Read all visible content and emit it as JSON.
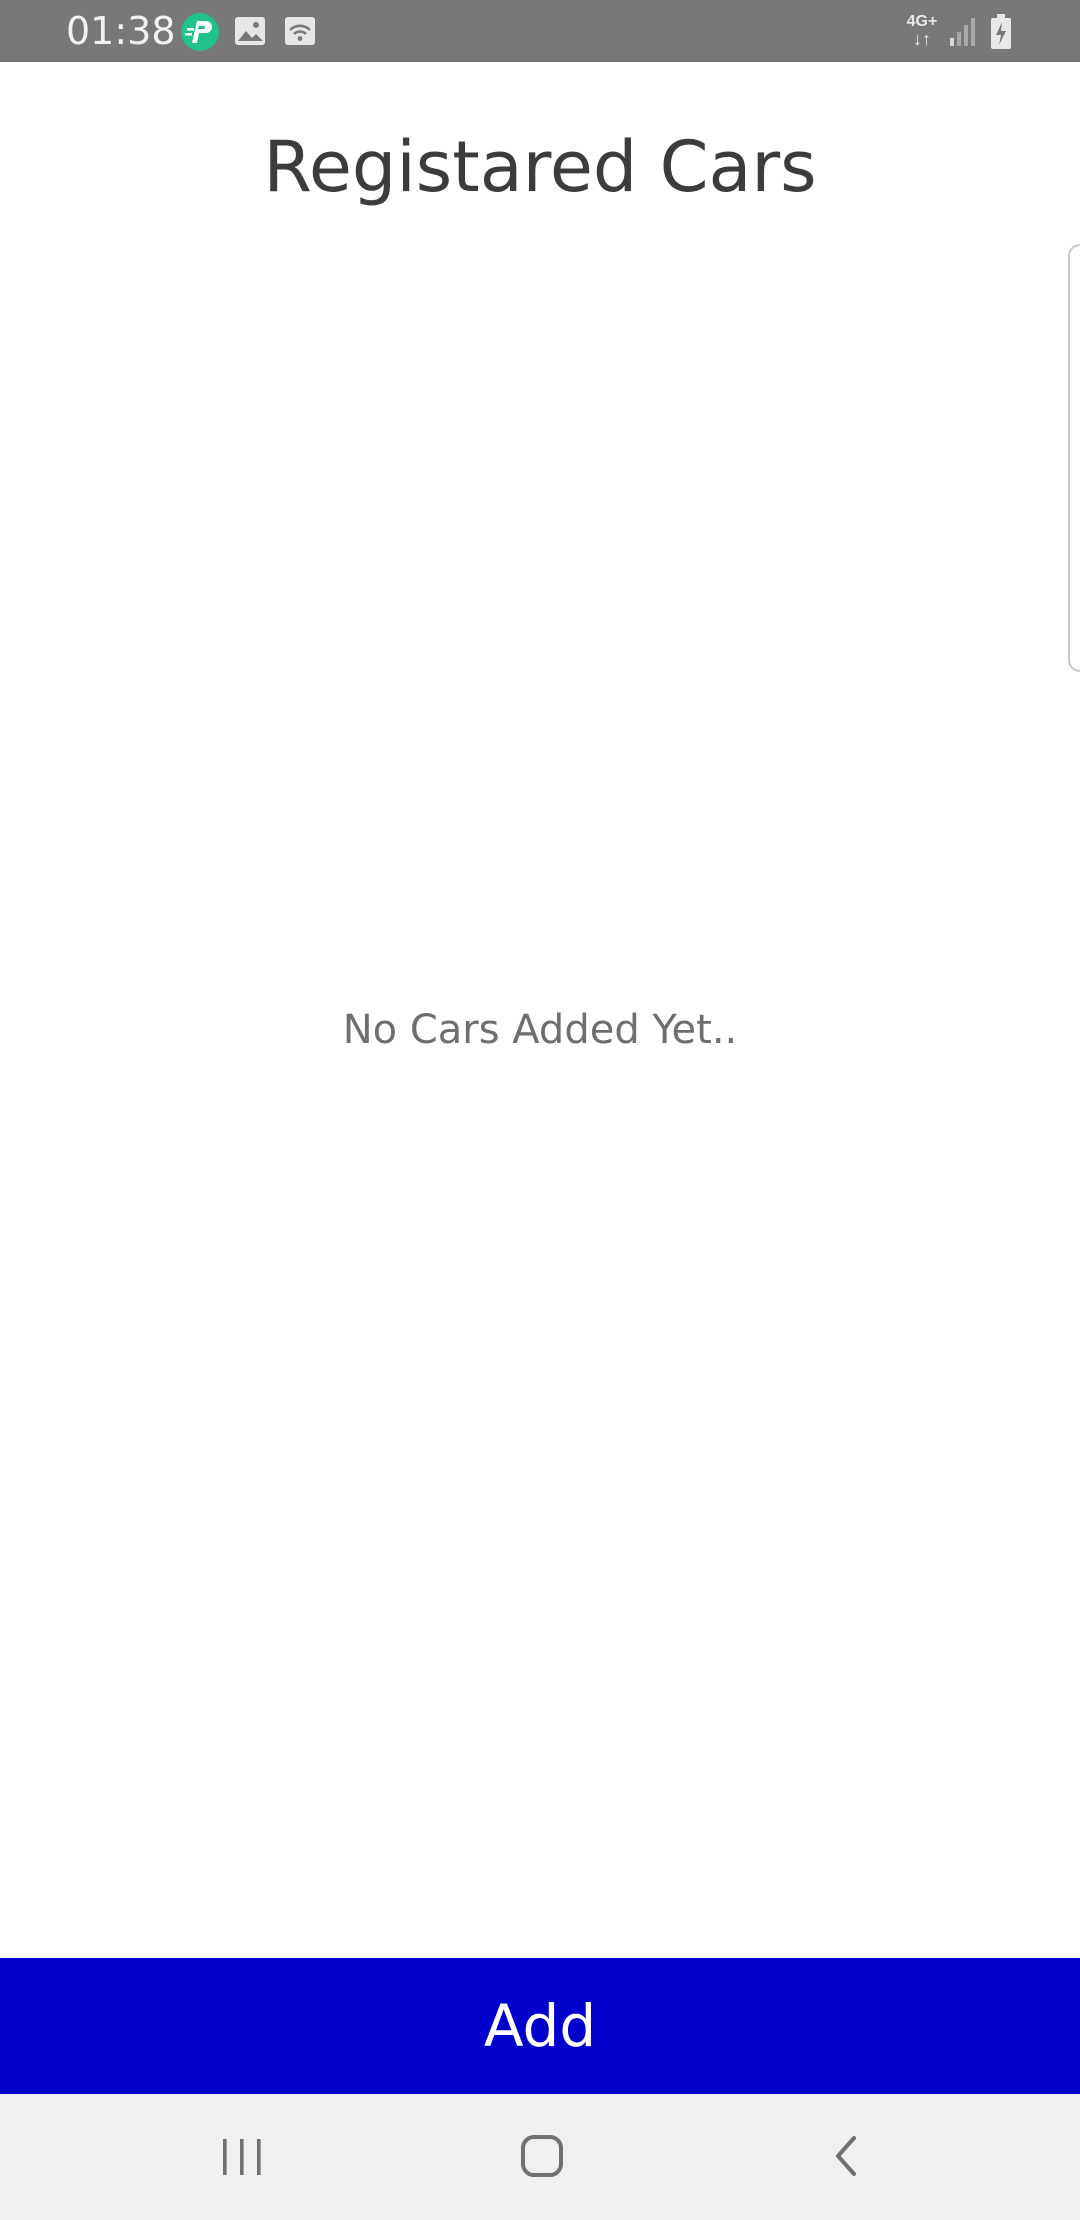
{
  "status_bar": {
    "time": "01:38",
    "network_label": "4G+",
    "network_arrows": "↓↑",
    "icons": [
      "app-notification-icon",
      "gallery-icon",
      "cast-icon",
      "network-4g-icon",
      "signal-icon",
      "battery-charging-icon"
    ]
  },
  "page": {
    "title": "Registared Cars",
    "empty_message": "No Cars Added Yet.."
  },
  "actions": {
    "add_label": "Add"
  },
  "nav_bar": {
    "icons": [
      "recent-apps-icon",
      "home-icon",
      "back-icon"
    ]
  },
  "colors": {
    "status_bar": "#787878",
    "accent_button": "#0000cc",
    "nav_bar": "#f0f0f0",
    "title_text": "#3c3c3c",
    "muted_text": "#6e6e6e",
    "app_icon": "#1fc28a"
  }
}
